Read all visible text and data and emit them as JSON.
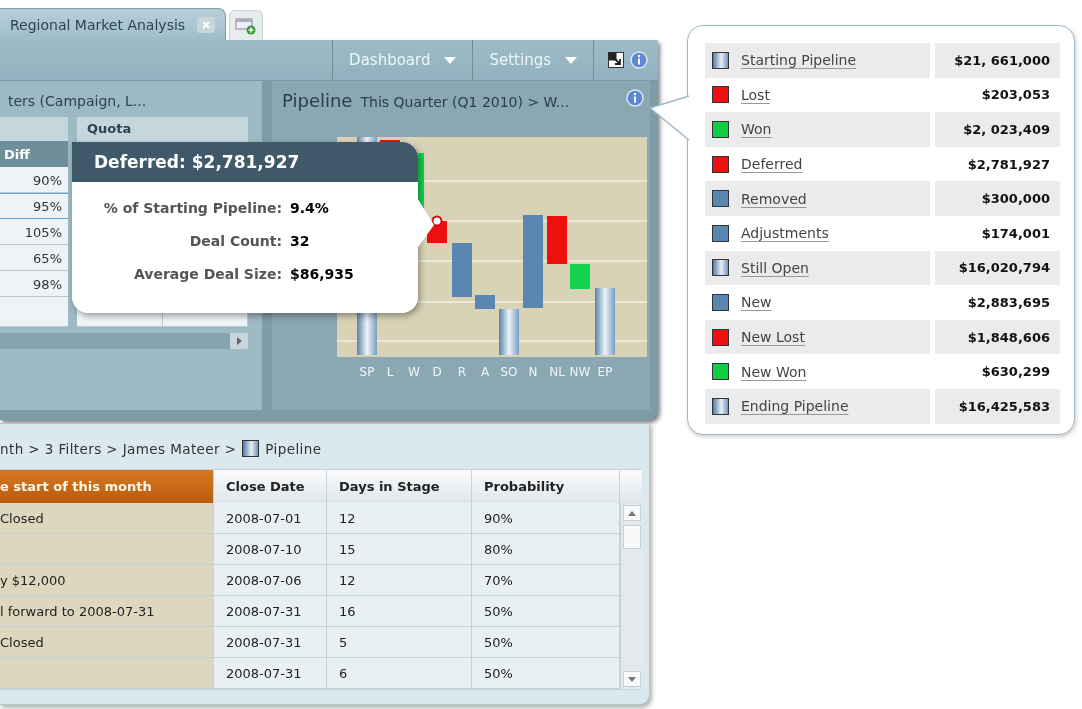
{
  "tabs": [
    {
      "label": "Regional Market Analysis",
      "selected": true
    }
  ],
  "toolbar": {
    "menus": [
      "Dashboard",
      "Settings"
    ]
  },
  "filters_panel": {
    "title": "ters (Campaign, L...",
    "diff_header": "Diff",
    "quota_header": "Quota",
    "rows": [
      {
        "value": "90%",
        "selected": false
      },
      {
        "value": "95%",
        "selected": true
      },
      {
        "value": "105%",
        "selected": false
      },
      {
        "value": "65%",
        "selected": false
      },
      {
        "value": "98%",
        "selected": false
      }
    ]
  },
  "pipeline_panel": {
    "title": "Pipeline",
    "subtitle": "This Quarter (Q1 2010) > W...",
    "axis_labels": [
      "SP",
      "L",
      "W",
      "D",
      "R",
      "A",
      "SO",
      "N",
      "NL",
      "NW",
      "EP"
    ]
  },
  "tooltip": {
    "title": "Deferred: $2,781,927",
    "rows": [
      {
        "label": "% of Starting Pipeline:",
        "value": "9.4%"
      },
      {
        "label": "Deal Count:",
        "value": "32"
      },
      {
        "label": "Average Deal Size:",
        "value": "$86,935"
      }
    ]
  },
  "legend": {
    "items": [
      {
        "label": "Starting Pipeline",
        "value": "$21, 661,000",
        "kind": "total"
      },
      {
        "label": "Lost",
        "value": "$203,053",
        "kind": "loss"
      },
      {
        "label": "Won",
        "value": "$2, 023,409",
        "kind": "gain"
      },
      {
        "label": "Deferred",
        "value": "$2,781,927",
        "kind": "loss"
      },
      {
        "label": "Removed",
        "value": "$300,000",
        "kind": "change"
      },
      {
        "label": "Adjustments",
        "value": "$174,001",
        "kind": "change"
      },
      {
        "label": "Still Open",
        "value": "$16,020,794",
        "kind": "total"
      },
      {
        "label": "New",
        "value": "$2,883,695",
        "kind": "change"
      },
      {
        "label": "New Lost",
        "value": "$1,848,606",
        "kind": "loss"
      },
      {
        "label": "New Won",
        "value": "$630,299",
        "kind": "gain"
      },
      {
        "label": "Ending Pipeline",
        "value": "$16,425,583",
        "kind": "total"
      }
    ]
  },
  "breadcrumb": {
    "path": "nth > 3 Filters > James Mateer >",
    "current": "Pipeline"
  },
  "deals_table": {
    "columns": [
      "e start of this month",
      "Close Date",
      "Days in Stage",
      "Probability"
    ],
    "rows": [
      {
        "column_1": "Closed",
        "close_date": "2008-07-01",
        "days_in_stage": "12",
        "probability": "90%"
      },
      {
        "close_date": "2008-07-10",
        "days_in_stage": "15",
        "probability": "80%"
      },
      {
        "column_1": "y $12,000",
        "close_date": "2008-07-06",
        "days_in_stage": "12",
        "probability": "70%"
      },
      {
        "column_1": "l forward to 2008-07-31",
        "close_date": "2008-07-31",
        "days_in_stage": "16",
        "probability": "50%"
      },
      {
        "column_1": "Closed",
        "close_date": "2008-07-31",
        "days_in_stage": "5",
        "probability": "50%"
      },
      {
        "close_date": "2008-07-31",
        "days_in_stage": "6",
        "probability": "50%"
      }
    ]
  }
}
